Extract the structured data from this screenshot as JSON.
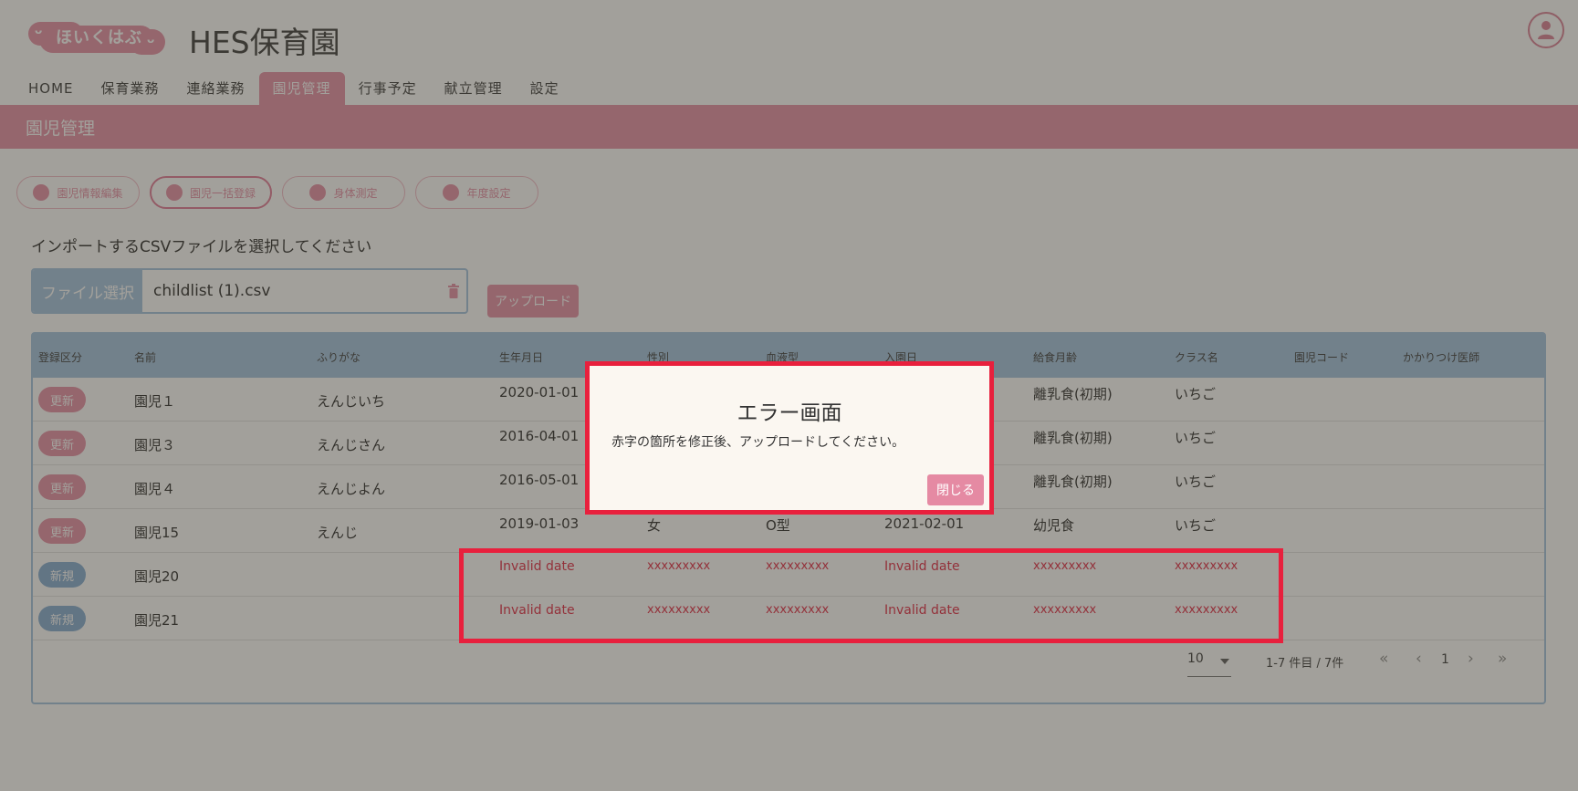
{
  "logo": {
    "text": "ほいくはぶ"
  },
  "site_title": "HES保育園",
  "nav": [
    {
      "label": "HOME"
    },
    {
      "label": "保育業務"
    },
    {
      "label": "連絡業務"
    },
    {
      "label": "園児管理"
    },
    {
      "label": "行事予定"
    },
    {
      "label": "献立管理"
    },
    {
      "label": "設定"
    }
  ],
  "page_title": "園児管理",
  "tabs": [
    {
      "label": "園児情報編集"
    },
    {
      "label": "園児一括登録"
    },
    {
      "label": "身体測定"
    },
    {
      "label": "年度設定"
    }
  ],
  "import_prompt": "インポートするCSVファイルを選択してください",
  "file_select": {
    "button_label": "ファイル選択",
    "file_name": "childlist (1).csv"
  },
  "upload_label": "アップロード",
  "table": {
    "headers": [
      "登録区分",
      "名前",
      "ふりがな",
      "生年月日",
      "性別",
      "血液型",
      "入園日",
      "給食月齢",
      "クラス名",
      "園児コード",
      "かかりつけ医師"
    ],
    "rows": [
      {
        "status": "更新",
        "name": "園児１",
        "furigana": "えんじいち",
        "birth": "2020-01-01",
        "gender": "",
        "blood": "",
        "entry": "",
        "meal": "離乳食(初期)",
        "class": "いちご"
      },
      {
        "status": "更新",
        "name": "園児３",
        "furigana": "えんじさん",
        "birth": "2016-04-01",
        "gender": "",
        "blood": "",
        "entry": "",
        "meal": "離乳食(初期)",
        "class": "いちご"
      },
      {
        "status": "更新",
        "name": "園児４",
        "furigana": "えんじよん",
        "birth": "2016-05-01",
        "gender": "",
        "blood": "",
        "entry": "",
        "meal": "離乳食(初期)",
        "class": "いちご"
      },
      {
        "status": "更新",
        "name": "園児15",
        "furigana": "えんじ",
        "birth": "2019-01-03",
        "gender": "女",
        "blood": "O型",
        "entry": "2021-02-01",
        "meal": "幼児食",
        "class": "いちご"
      },
      {
        "status": "新規",
        "name": "園児20",
        "furigana": "",
        "birth": "Invalid date",
        "gender": "xxxxxxxxx",
        "blood": "xxxxxxxxx",
        "entry": "Invalid date",
        "meal": "xxxxxxxxx",
        "class": "xxxxxxxxx"
      },
      {
        "status": "新規",
        "name": "園児21",
        "furigana": "",
        "birth": "Invalid date",
        "gender": "xxxxxxxxx",
        "blood": "xxxxxxxxx",
        "entry": "Invalid date",
        "meal": "xxxxxxxxx",
        "class": "xxxxxxxxx"
      }
    ]
  },
  "pagination": {
    "per_page": "10",
    "count": "1-7 件目 / 7件",
    "page": "1",
    "first": "«",
    "prev": "‹",
    "next": "›",
    "last": "»"
  },
  "modal": {
    "title": "エラー画面",
    "message": "赤字の箇所を修正後、アップロードしてください。",
    "close_label": "閉じる"
  },
  "colors": {
    "brand_pink": "#e58aa3",
    "table_blue": "#9fc0df",
    "error_red": "#e0203d",
    "highlight_red": "#e8203d"
  }
}
